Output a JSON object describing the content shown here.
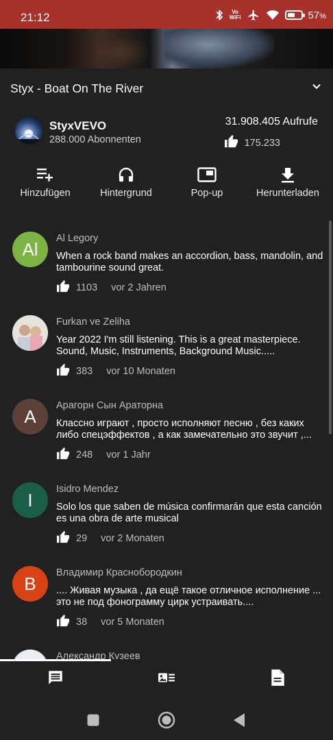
{
  "status_bar": {
    "time": "21:12",
    "vowifi_top": "Vo",
    "vowifi_bottom": "WiFi",
    "battery": "57",
    "battery_unit": "%",
    "battery_level": 0.57,
    "icons": [
      "bluetooth-icon",
      "vowifi-icon",
      "airplane-icon",
      "wifi-icon",
      "battery-icon"
    ]
  },
  "video": {
    "title": "Styx - Boat On The River",
    "expand_icon": "chevron-down-icon"
  },
  "channel": {
    "name": "StyxVEVO",
    "subscribers": "288.000 Abonnenten",
    "views": "31.908.405 Aufrufe",
    "likes": "175.233"
  },
  "actions": [
    {
      "label": "Hinzufügen",
      "icon": "playlist-add-icon"
    },
    {
      "label": "Hintergrund",
      "icon": "headphones-icon"
    },
    {
      "label": "Pop-up",
      "icon": "picture-in-picture-icon"
    },
    {
      "label": "Herunterladen",
      "icon": "download-icon"
    }
  ],
  "comments": [
    {
      "initials": "Al",
      "avatar_color": "#7cb342",
      "author": "Al Legory",
      "text": "When a rock band makes an accordion, bass, mandolin, and tambourine sound great.",
      "likes": "1103",
      "age": "vor 2 Jahren"
    },
    {
      "initials": "",
      "avatar_color": "#cfd6e0",
      "author": "Furkan ve Zeliha",
      "text": "Year 2022 I'm still listening. This is a great masterpiece. Sound, Music, Instruments, Background Music.....",
      "likes": "383",
      "age": "vor 10 Monaten"
    },
    {
      "initials": "A",
      "avatar_color": "#5d4037",
      "author": "Арагорн Сын Араторна",
      "text": "Классно играют , просто исполняют песню , без каких либо спецэффектов , а как замечательно это звучит ,...",
      "likes": "248",
      "age": "vor 1 Jahr"
    },
    {
      "initials": "I",
      "avatar_color": "#1b5e4a",
      "author": "Isidro Mendez",
      "text": "Solo los que saben de música confirmarán que esta canción es una obra de arte musical",
      "likes": "29",
      "age": "vor 2 Monaten"
    },
    {
      "initials": "B",
      "avatar_color": "#d84315",
      "author": "Владимир Краснобородкин",
      "text": ".... Живая музыка , да ещё такое отличное исполнение ... это не под фонограмму цирк устраивать....",
      "likes": "38",
      "age": "vor 5 Monaten"
    },
    {
      "initials": "",
      "avatar_color": "#dfe6ef",
      "author": "Александр Кузеев",
      "text": "",
      "likes": "",
      "age": ""
    }
  ],
  "bottom_tabs": [
    {
      "icon": "comments-icon",
      "active": true
    },
    {
      "icon": "related-videos-icon",
      "active": false
    },
    {
      "icon": "description-icon",
      "active": false
    }
  ],
  "nav_bar": [
    "recents-button",
    "home-button",
    "back-button"
  ]
}
